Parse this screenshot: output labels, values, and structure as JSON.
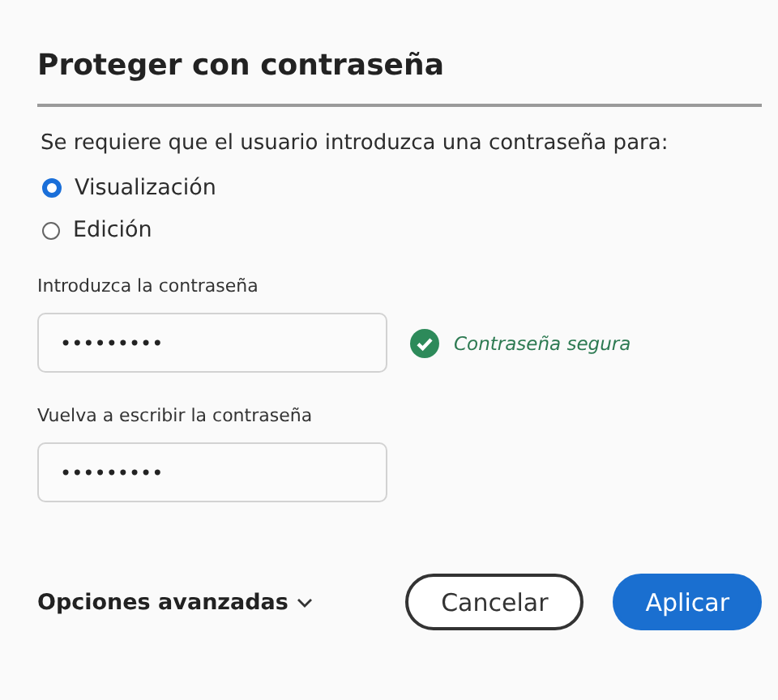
{
  "dialog": {
    "title": "Proteger con contraseña"
  },
  "prompt": "Se requiere que el usuario introduzca una contraseña para:",
  "options": [
    {
      "label": "Visualización",
      "selected": true
    },
    {
      "label": "Edición",
      "selected": false
    }
  ],
  "password": {
    "label": "Introduzca la contraseña",
    "value": "•••••••••",
    "strength_ok": true,
    "strength": "Contraseña segura"
  },
  "confirm": {
    "label": "Vuelva a escribir la contraseña",
    "value": "•••••••••"
  },
  "advanced": {
    "label": "Opciones avanzadas",
    "expanded": false
  },
  "buttons": [
    {
      "label": "Cancelar",
      "kind": "secondary"
    },
    {
      "label": "Aplicar",
      "kind": "primary"
    }
  ]
}
